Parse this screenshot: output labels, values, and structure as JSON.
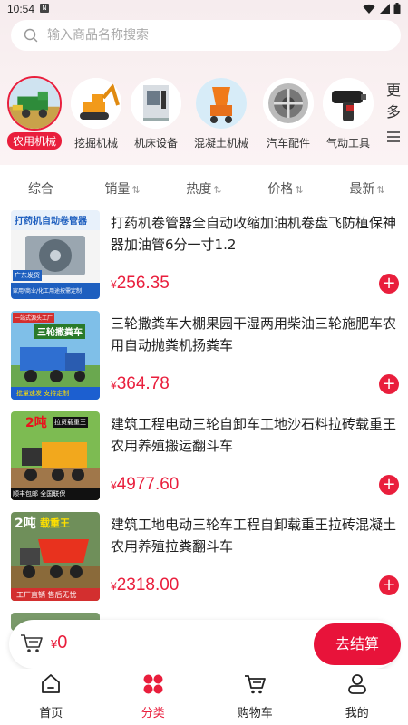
{
  "status_bar": {
    "time": "10:54",
    "notification": "N"
  },
  "search": {
    "placeholder": "输入商品名称搜索"
  },
  "categories": [
    {
      "label": "农用机械",
      "active": true
    },
    {
      "label": "挖掘机械",
      "active": false
    },
    {
      "label": "机床设备",
      "active": false
    },
    {
      "label": "混凝土机械",
      "active": false
    },
    {
      "label": "汽车配件",
      "active": false
    },
    {
      "label": "气动工具",
      "active": false
    }
  ],
  "more_label": "更多",
  "sort_tabs": [
    {
      "label": "综合",
      "has_arrow": false
    },
    {
      "label": "销量",
      "has_arrow": true
    },
    {
      "label": "热度",
      "has_arrow": true
    },
    {
      "label": "价格",
      "has_arrow": true
    },
    {
      "label": "最新",
      "has_arrow": true
    }
  ],
  "products": [
    {
      "title": "打药机卷管器全自动收缩加油机卷盘飞防植保神器加油管6分一寸1.2",
      "currency": "¥",
      "price": "256.35",
      "thumb_text": "打药机自动卷管器",
      "thumb_badge": "广东发货",
      "thumb_caption": "家用/商业/化工用途按需定制",
      "thumb_brand": ""
    },
    {
      "title": "三轮撒粪车大棚果园干湿两用柴油三轮施肥车农用自动抛粪机扬粪车",
      "currency": "¥",
      "price": "364.78",
      "thumb_text": "三轮撒粪车",
      "thumb_badge": "",
      "thumb_caption": "批量速发 支持定制",
      "thumb_brand": "一站式源头工厂"
    },
    {
      "title": "建筑工程电动三轮自卸车工地沙石料拉砖载重王农用养殖搬运翻斗车",
      "currency": "¥",
      "price": "4977.60",
      "thumb_text": "2吨",
      "thumb_badge": "拉货载重王",
      "thumb_caption": "顺丰包邮 全国联保",
      "thumb_brand": ""
    },
    {
      "title": "建筑工地电动三轮车工程自卸载重王拉砖混凝土农用养殖拉粪翻斗车",
      "currency": "¥",
      "price": "2318.00",
      "thumb_text": "2吨",
      "thumb_badge": "载重王",
      "thumb_caption": "工厂直销 售后无忧",
      "thumb_brand": ""
    }
  ],
  "cart": {
    "currency": "¥",
    "total": "0",
    "checkout_label": "去结算"
  },
  "tabbar": [
    {
      "label": "首页",
      "icon": "home-icon",
      "active": false
    },
    {
      "label": "分类",
      "icon": "category-icon",
      "active": true
    },
    {
      "label": "购物车",
      "icon": "cart-icon",
      "active": false
    },
    {
      "label": "我的",
      "icon": "profile-icon",
      "active": false
    }
  ],
  "colors": {
    "accent": "#e91e3c",
    "background_top": "#f6ecee"
  }
}
